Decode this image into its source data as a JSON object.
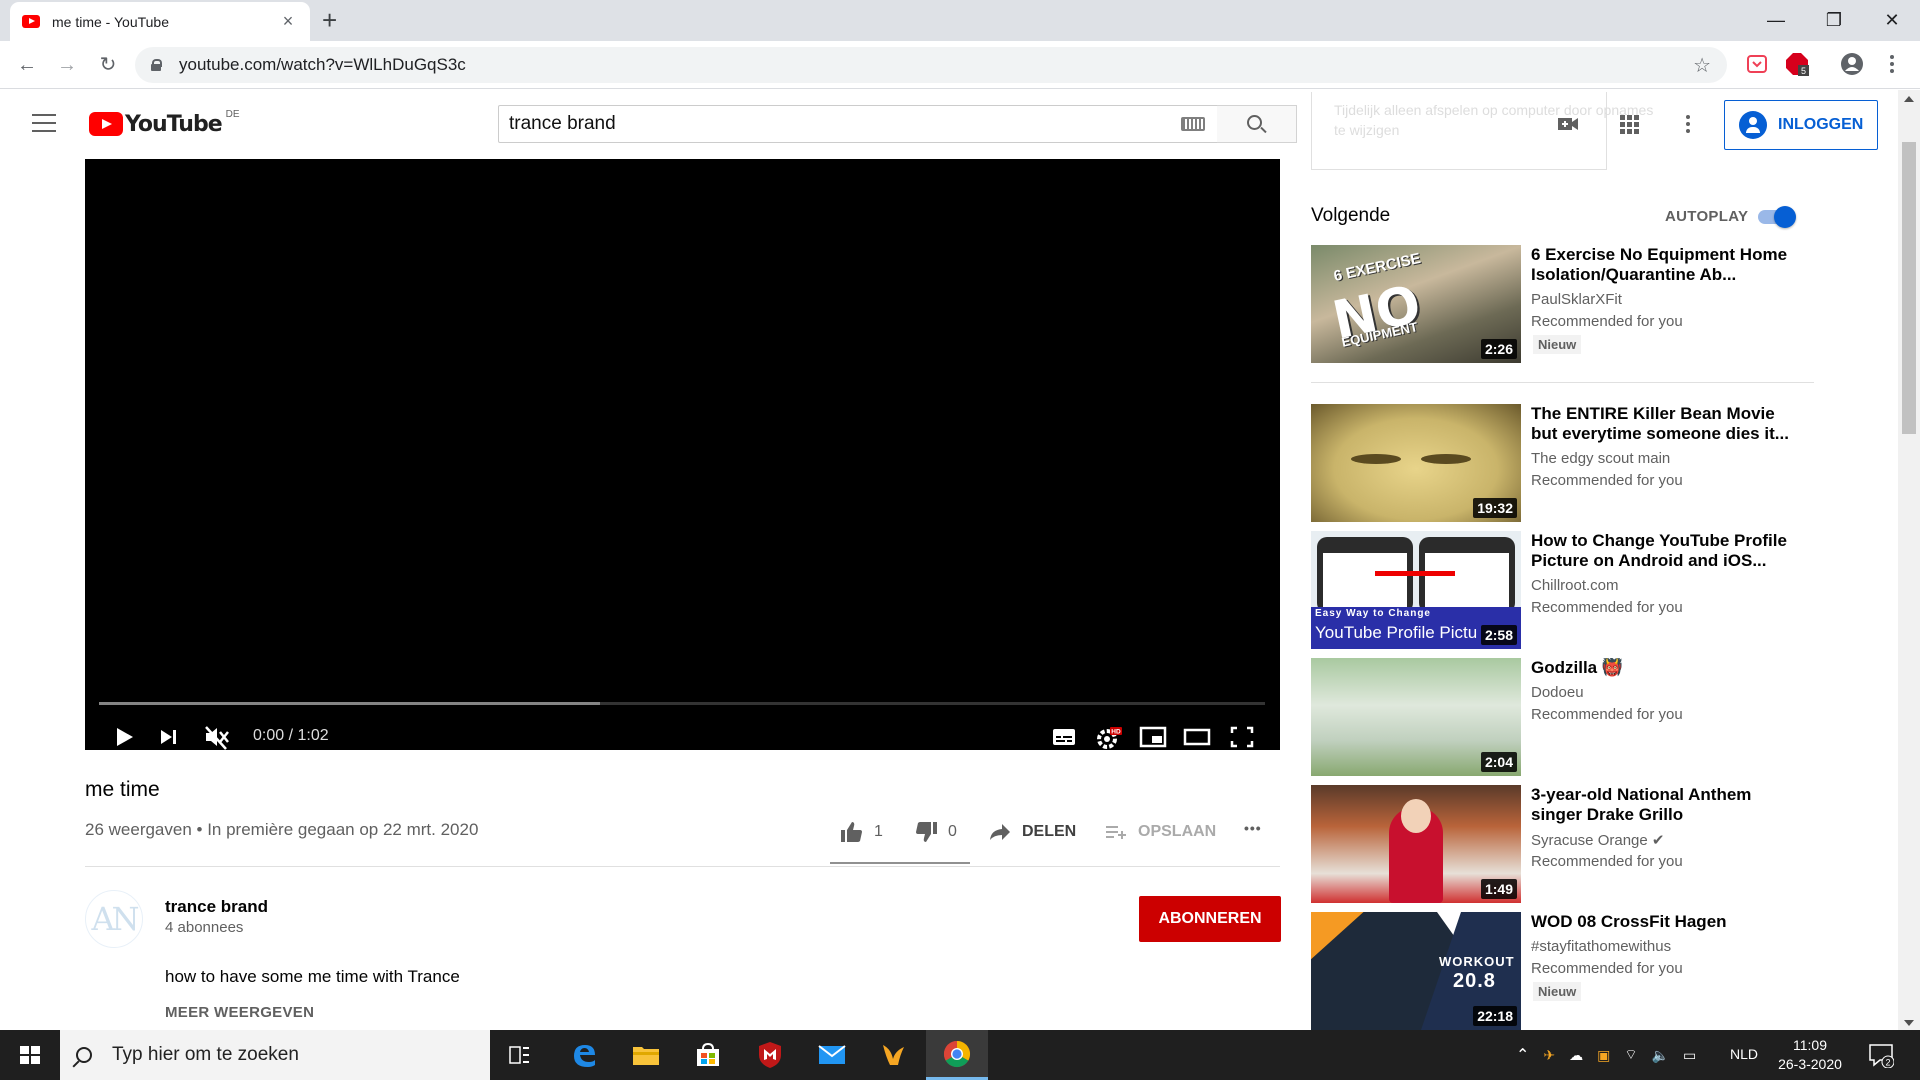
{
  "browser": {
    "tab_title": "me time - YouTube",
    "tab_close": "×",
    "new_tab": "+",
    "url": "youtube.com/watch?v=WlLhDuGqS3c",
    "window_controls": {
      "minimize": "—",
      "restore": "❐",
      "close": "✕"
    },
    "nav": {
      "back": "←",
      "forward": "→",
      "reload": "↻"
    },
    "extensions": [
      {
        "name": "pocket-extension",
        "color": "#ef4056"
      },
      {
        "name": "adblock-extension",
        "color": "#d6001c",
        "badge": "5"
      },
      {
        "name": "profile-icon",
        "color": "#5f6368"
      }
    ]
  },
  "masthead": {
    "logo_word": "YouTube",
    "country_code": "DE",
    "search_value": "trance brand",
    "signin_label": "INLOGGEN",
    "brand_color": "#ff0000",
    "accent_color": "#065fd4"
  },
  "player": {
    "time": "0:00 / 1:02",
    "duration_seconds": 62,
    "buffered_fraction": 0.43
  },
  "video": {
    "title": "me time",
    "meta": "26 weergaven • In première gegaan op 22 mrt. 2020",
    "likes": "1",
    "dislikes": "0",
    "share_label": "DELEN",
    "save_label": "OPSLAAN",
    "more": "•••"
  },
  "channel": {
    "name": "trance brand",
    "subscribers": "4 abonnees",
    "avatar_text": "AN",
    "subscribe_label": "ABONNEREN",
    "description": "how to have some me time with Trance",
    "show_more": "MEER WEERGEVEN"
  },
  "sidebar": {
    "ghost_text": "Tijdelijk alleen afspelen op computer door opnames te wijzigen",
    "next_label": "Volgende",
    "autoplay_label": "AUTOPLAY",
    "autoplay_on": true,
    "recommendations": [
      {
        "title": "6 Exercise No Equipment Home Isolation/Quarantine Ab...",
        "channel": "PaulSklarXFit",
        "reason": "Recommended for you",
        "badge": "Nieuw",
        "duration": "2:26",
        "thumb_big": "NO",
        "thumb_sm": "6 EXERCISE",
        "thumb_sm2": "EQUIPMENT"
      },
      {
        "title": "The ENTIRE Killer Bean Movie but everytime someone dies it...",
        "channel": "The edgy scout main",
        "reason": "Recommended for you",
        "badge": "",
        "duration": "19:32"
      },
      {
        "title": "How to Change YouTube Profile Picture on Android and iOS...",
        "channel": "Chillroot.com",
        "reason": "Recommended for you",
        "badge": "",
        "duration": "2:58",
        "thumb_s1": "Easy Way to Change",
        "thumb_s2": "YouTube Profile Pictu"
      },
      {
        "title": "Godzilla 👹",
        "channel": "Dodoeu",
        "reason": "Recommended for you",
        "badge": "",
        "duration": "2:04"
      },
      {
        "title": "3-year-old National Anthem singer Drake Grillo",
        "channel": "Syracuse Orange ✔",
        "reason": "Recommended for you",
        "badge": "",
        "duration": "1:49"
      },
      {
        "title": "WOD 08 CrossFit Hagen",
        "channel": "#stayfitathomewithus",
        "reason": "Recommended for you",
        "badge": "Nieuw",
        "duration": "22:18",
        "thumb_w1": "WORKOUT",
        "thumb_w2": "20.8"
      }
    ]
  },
  "taskbar": {
    "search_placeholder": "Typ hier om te zoeken",
    "language": "NLD",
    "time": "11:09",
    "date": "26-3-2020",
    "notifications": "2"
  }
}
